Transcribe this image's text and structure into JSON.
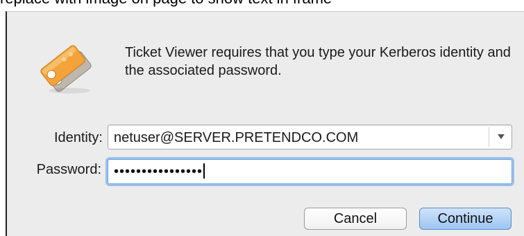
{
  "header_snippet": "replace with image on page to show text in frame",
  "dialog": {
    "icon": "kerberos-tickets-icon",
    "message": "Ticket Viewer requires that you type your Kerberos identity and the associated password.",
    "identity_label": "Identity:",
    "identity_value": "netuser@SERVER.PRETENDCO.COM",
    "password_label": "Password:",
    "password_mask": "••••••••••••••••",
    "cancel_label": "Cancel",
    "continue_label": "Continue"
  },
  "colors": {
    "dialog_background": "#ececec",
    "focus_ring": "#5e9ce7",
    "default_button": "#9cc6f1"
  }
}
